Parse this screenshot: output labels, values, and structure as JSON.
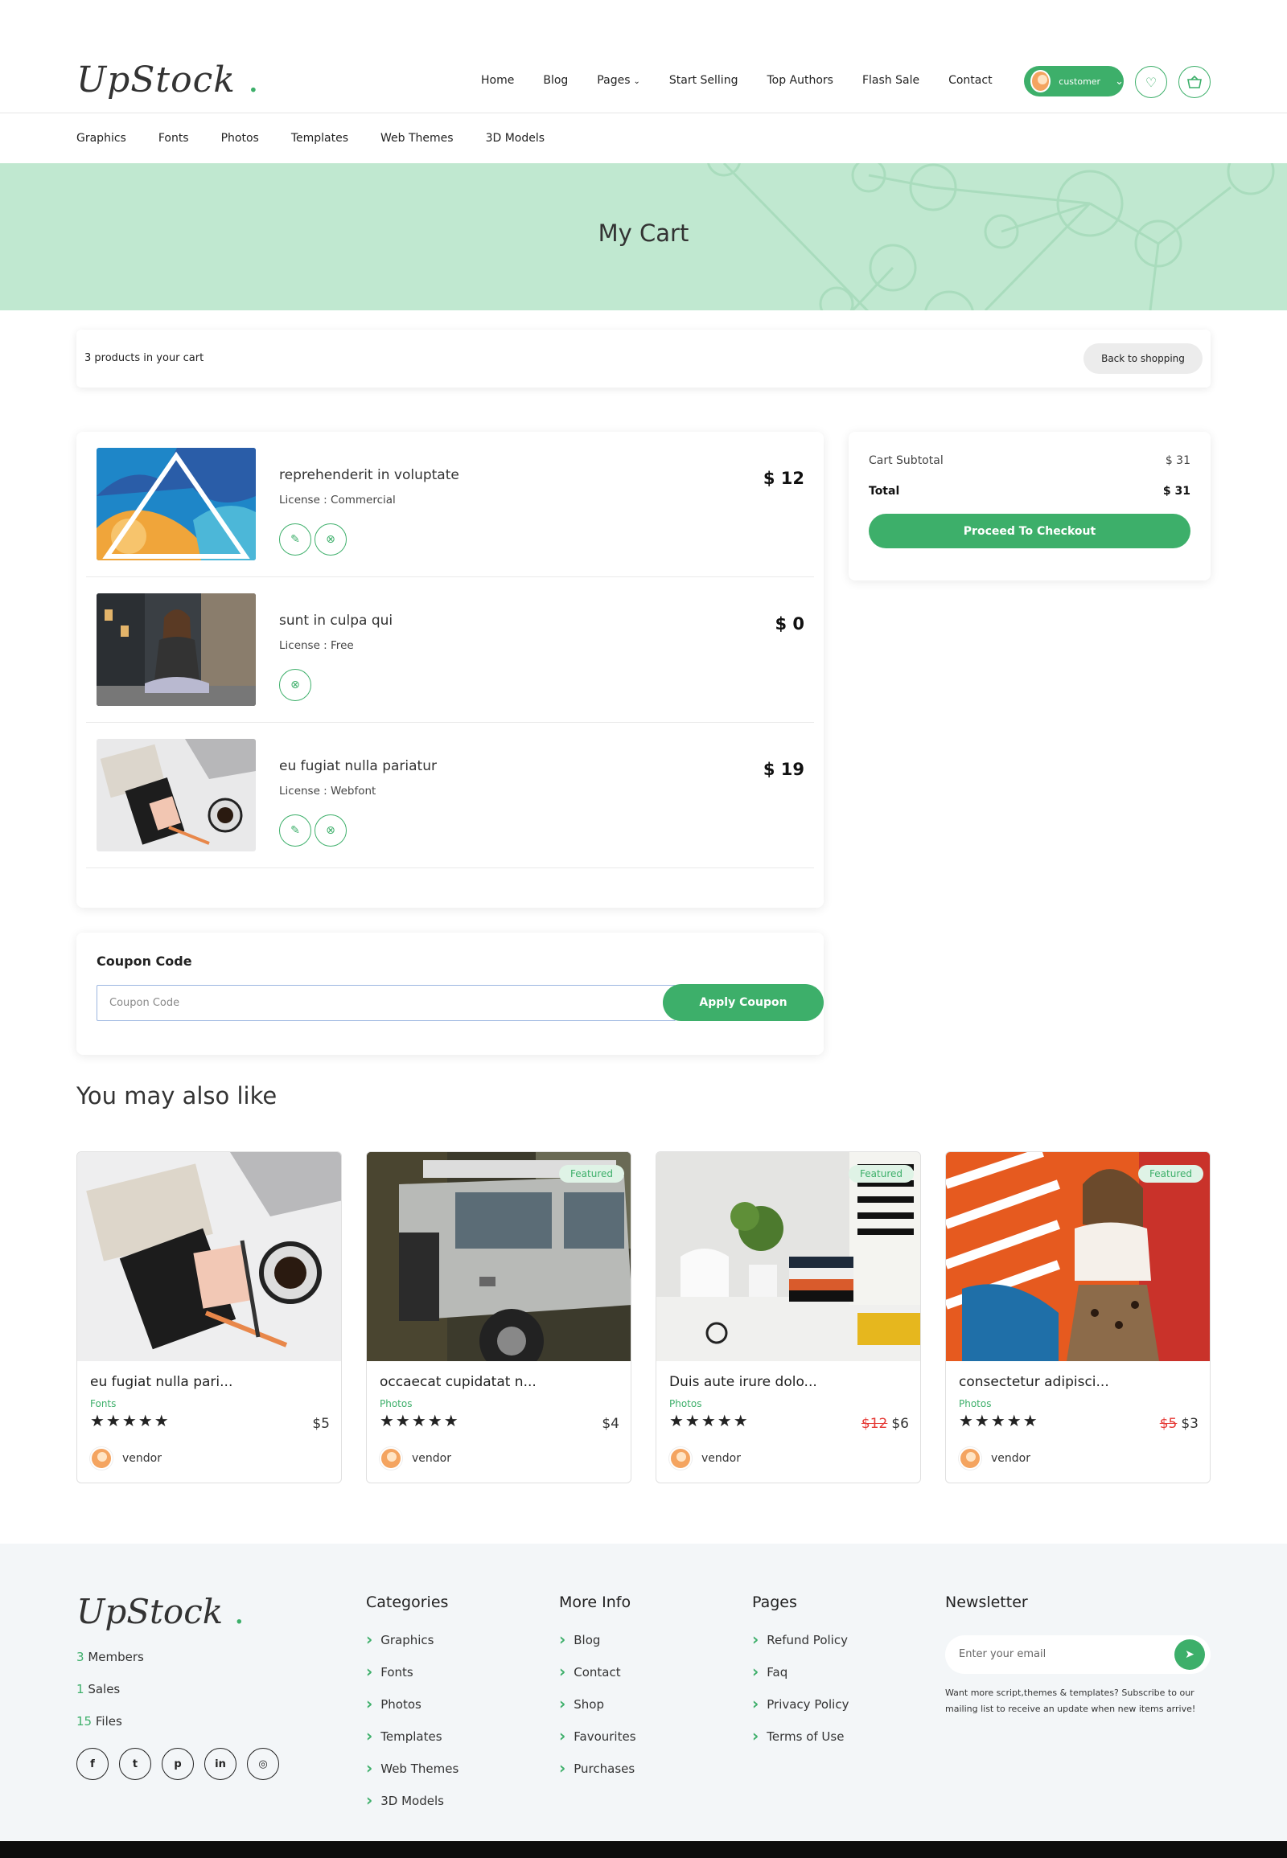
{
  "header": {
    "logo": "UpStock",
    "logo_dot": ".",
    "nav": [
      "Home",
      "Blog",
      "Pages",
      "Start Selling",
      "Top Authors",
      "Flash Sale",
      "Contact"
    ],
    "user_label": "customer"
  },
  "subnav": [
    "Graphics",
    "Fonts",
    "Photos",
    "Templates",
    "Web Themes",
    "3D Models"
  ],
  "hero": {
    "title": "My Cart"
  },
  "cart_bar": {
    "count_text": "3 products in your cart",
    "back_label": "Back to shopping"
  },
  "cart_items": [
    {
      "name": "reprehenderit in voluptate",
      "license": "License : Commercial",
      "price": "$ 12"
    },
    {
      "name": "sunt in culpa qui",
      "license": "License : Free",
      "price": "$ 0"
    },
    {
      "name": "eu fugiat nulla pariatur",
      "license": "License : Webfont",
      "price": "$ 19"
    }
  ],
  "summary": {
    "subtotal_label": "Cart Subtotal",
    "subtotal_value": "$ 31",
    "total_label": "Total",
    "total_value": "$ 31",
    "checkout_label": "Proceed To Checkout"
  },
  "coupon": {
    "title": "Coupon Code",
    "placeholder": "Coupon Code",
    "button": "Apply Coupon"
  },
  "also_like": {
    "title": "You may also like",
    "featured_label": "Featured",
    "cards": [
      {
        "title": "eu fugiat nulla pari...",
        "category": "Fonts",
        "stars": "★★★★★",
        "old_price": "",
        "price": "$5",
        "vendor": "vendor"
      },
      {
        "title": "occaecat cupidatat n...",
        "category": "Photos",
        "stars": "★★★★★",
        "old_price": "",
        "price": "$4",
        "vendor": "vendor"
      },
      {
        "title": "Duis aute irure dolo...",
        "category": "Photos",
        "stars": "★★★★★",
        "old_price": "$12",
        "price": "$6",
        "vendor": "vendor"
      },
      {
        "title": "consectetur adipisci...",
        "category": "Photos",
        "stars": "★★★★★",
        "old_price": "$5",
        "price": "$3",
        "vendor": "vendor"
      }
    ]
  },
  "footer": {
    "logo": "UpStock",
    "stats": [
      {
        "num": "3",
        "label": " Members"
      },
      {
        "num": "1",
        "label": " Sales"
      },
      {
        "num": "15",
        "label": " Files"
      }
    ],
    "categories": {
      "title": "Categories",
      "items": [
        "Graphics",
        "Fonts",
        "Photos",
        "Templates",
        "Web Themes",
        "3D Models"
      ]
    },
    "more_info": {
      "title": "More Info",
      "items": [
        "Blog",
        "Contact",
        "Shop",
        "Favourites",
        "Purchases"
      ]
    },
    "pages": {
      "title": "Pages",
      "items": [
        "Refund Policy",
        "Faq",
        "Privacy Policy",
        "Terms of Use"
      ]
    },
    "newsletter": {
      "title": "Newsletter",
      "placeholder": "Enter your email",
      "text": "Want more script,themes & templates? Subscribe to our mailing list to receive an update when new items arrive!"
    }
  },
  "colors": {
    "accent": "#3daf6a",
    "hero_bg": "#c0e8d0",
    "footer_bg": "#f3f6f8",
    "old_price": "#e53935"
  }
}
